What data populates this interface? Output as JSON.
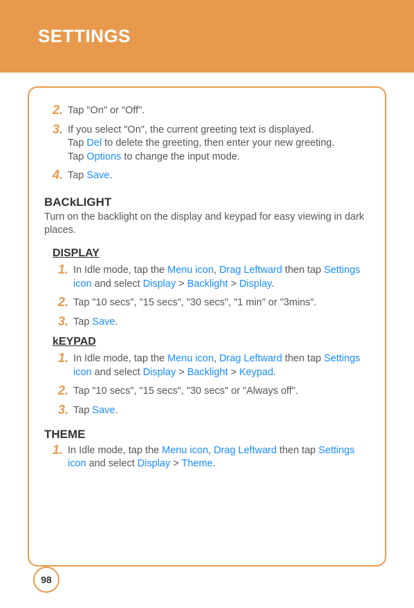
{
  "header": {
    "title": "SETTINGS"
  },
  "intro_steps": {
    "s2": {
      "num": "2.",
      "text": "Tap \"On\" or \"Off\"."
    },
    "s3": {
      "num": "3.",
      "line1_a": "If you select \"On\", the current greeting text is displayed.",
      "line2_a": "Tap ",
      "line2_link": "Del",
      "line2_b": " to delete the greeting, then enter your new greeting.",
      "line3_a": "Tap ",
      "line3_link": "Options",
      "line3_b": " to change the input mode."
    },
    "s4": {
      "num": "4.",
      "pre": "Tap ",
      "link": "Save",
      "post": "."
    }
  },
  "backlight": {
    "heading": "BACkLIGHT",
    "desc": "Turn on the backlight on the display and keypad for easy viewing in dark places."
  },
  "display": {
    "heading": "DISPLAY",
    "s1": {
      "num": "1.",
      "a": "In Idle mode, tap the ",
      "menu": "Menu icon",
      "comma": ", ",
      "drag": "Drag Leftward",
      "b": " then tap ",
      "settings": "Settings icon",
      "c": " and select ",
      "d1": "Display",
      "gt1": " > ",
      "d2": "Backlight",
      "gt2": " > ",
      "d3": "Display",
      "end": "."
    },
    "s2": {
      "num": "2.",
      "text": "Tap \"10 secs\", \"15 secs\", \"30 secs\", \"1 min\" or \"3mins\"."
    },
    "s3": {
      "num": "3.",
      "pre": "Tap ",
      "link": "Save",
      "post": "."
    }
  },
  "keypad": {
    "heading": "kEYPAD",
    "s1": {
      "num": "1.",
      "a": "In Idle mode, tap the ",
      "menu": "Menu icon",
      "comma": ", ",
      "drag": "Drag Leftward",
      "b": " then tap ",
      "settings": "Settings icon",
      "c": " and select ",
      "d1": "Display",
      "gt1": " > ",
      "d2": "Backlight",
      "gt2": " > ",
      "d3": "Keypad",
      "end": "."
    },
    "s2": {
      "num": "2.",
      "text": "Tap \"10 secs\", \"15 secs\", \"30 secs\" or \"Always off\"."
    },
    "s3": {
      "num": "3.",
      "pre": "Tap ",
      "link": "Save",
      "post": "."
    }
  },
  "theme": {
    "heading": "THEME",
    "s1": {
      "num": "1.",
      "a": "In Idle mode, tap the ",
      "menu": "Menu icon",
      "comma": ", ",
      "drag": "Drag Leftward",
      "b": " then tap ",
      "settings": "Settings icon",
      "c": " and select ",
      "d1": "Display",
      "gt1": " > ",
      "d2": "Theme",
      "end": "."
    }
  },
  "page_number": "98"
}
